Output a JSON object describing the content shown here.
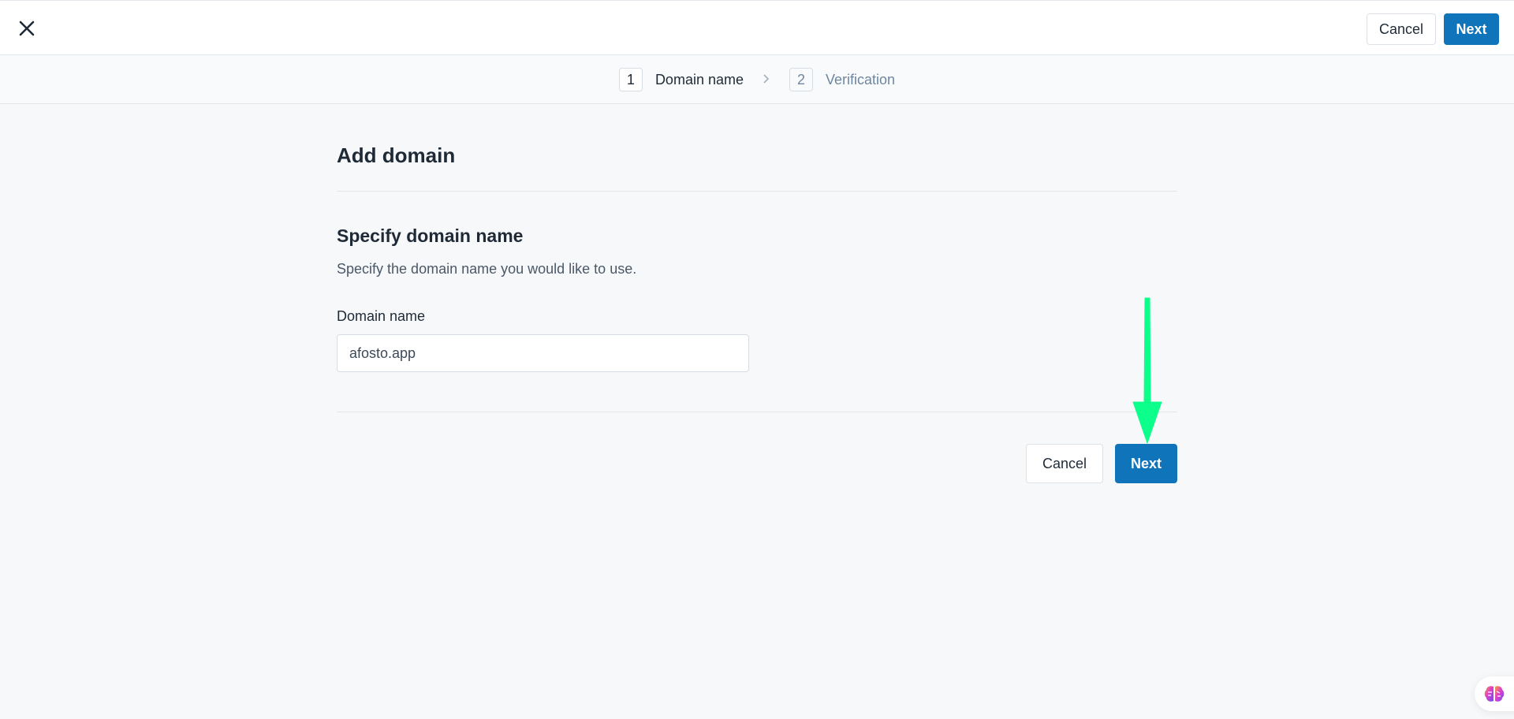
{
  "topbar": {
    "close_icon": "close-icon",
    "cancel_label": "Cancel",
    "next_label": "Next"
  },
  "steps": [
    {
      "number": "1",
      "label": "Domain name",
      "state": "active"
    },
    {
      "number": "2",
      "label": "Verification",
      "state": "inactive"
    }
  ],
  "step_separator_icon": "chevron-right-icon",
  "page": {
    "title": "Add domain",
    "section_title": "Specify domain name",
    "section_description": "Specify the domain name you would like to use.",
    "field": {
      "label": "Domain name",
      "value": "afosto.app",
      "placeholder": ""
    },
    "cancel_label": "Cancel",
    "next_label": "Next"
  },
  "annotation": {
    "type": "arrow",
    "color": "#0cff8a",
    "points_to": "next-button"
  },
  "assistant_widget": {
    "icon": "brain-icon"
  },
  "colors": {
    "primary": "#0f74b9",
    "text": "#1f2a37",
    "muted": "#6f86a0",
    "background": "#f7f8fa"
  }
}
